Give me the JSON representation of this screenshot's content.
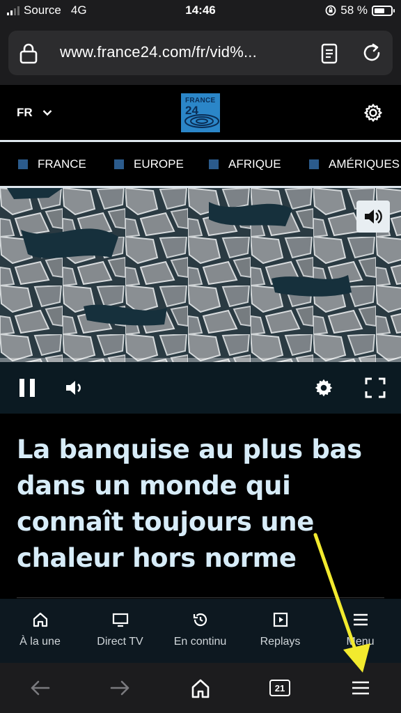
{
  "status_bar": {
    "carrier": "Source",
    "network": "4G",
    "time": "14:46",
    "battery": "58 %"
  },
  "address_bar": {
    "url": "www.france24.com/fr/vid%..."
  },
  "site_header": {
    "language": "FR",
    "logo_line1": "FRANCE",
    "logo_line2": "24"
  },
  "categories": [
    {
      "label": "FRANCE"
    },
    {
      "label": "EUROPE"
    },
    {
      "label": "AFRIQUE"
    },
    {
      "label": "AMÉRIQUES"
    }
  ],
  "article": {
    "headline": "La banquise au plus bas dans un monde qui connaît toujours une chaleur hors norme"
  },
  "site_nav": [
    {
      "label": "À la une",
      "icon": "home-icon"
    },
    {
      "label": "Direct TV",
      "icon": "tv-icon"
    },
    {
      "label": "En continu",
      "icon": "history-icon"
    },
    {
      "label": "Replays",
      "icon": "replay-icon"
    },
    {
      "label": "Menu",
      "icon": "menu-icon"
    }
  ],
  "toolbar": {
    "tab_count": "21"
  },
  "colors": {
    "brand_blue": "#2b86c8",
    "headline_color": "#d7ecf8",
    "annotation_arrow": "#f2ea2e"
  }
}
